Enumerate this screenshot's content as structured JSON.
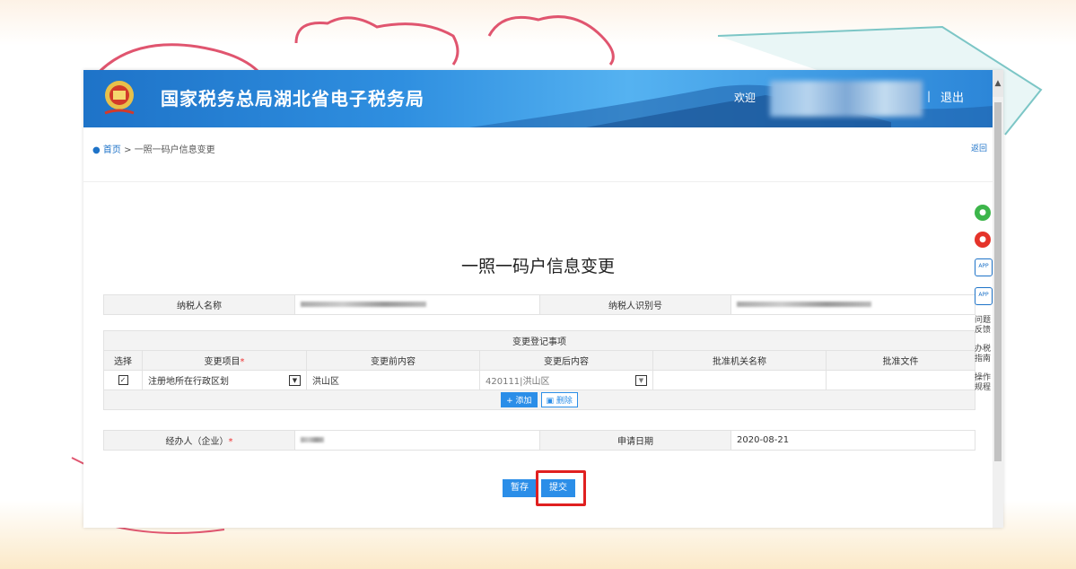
{
  "header": {
    "site_title": "国家税务总局湖北省电子税务局",
    "welcome": "欢迎",
    "separator": "|",
    "logout": "退出",
    "emblem_icon": "national-tax-emblem-icon"
  },
  "breadcrumb": {
    "home": "首页",
    "arrow": ">",
    "current": "一照一码户信息变更",
    "back": "返回"
  },
  "form": {
    "title": "一照一码户信息变更",
    "taxpayer_name_label": "纳税人名称",
    "taxpayer_id_label": "纳税人识别号",
    "section_title": "变更登记事项",
    "columns": [
      "选择",
      "变更项目",
      "变更前内容",
      "变更后内容",
      "批准机关名称",
      "批准文件"
    ],
    "required_mark": "*",
    "row": {
      "checkbox": "✓",
      "item": "注册地所在行政区划",
      "before": "洪山区",
      "after": "420111|洪山区",
      "approval_org": "",
      "approval_doc": ""
    },
    "add_button": "添加",
    "delete_button": "删除",
    "agent_label": "经办人（企业）",
    "apply_date_label": "申请日期",
    "apply_date": "2020-08-21",
    "save_button": "暂存",
    "submit_button": "提交"
  },
  "side_tools": {
    "feedback": "问题反馈",
    "guide": "办税指南",
    "rules": "操作规程",
    "app1": "APP",
    "app2": "APP"
  },
  "colors": {
    "banner": "#2f8fe0",
    "accent": "#2b8ee8",
    "highlight": "#e02020"
  }
}
